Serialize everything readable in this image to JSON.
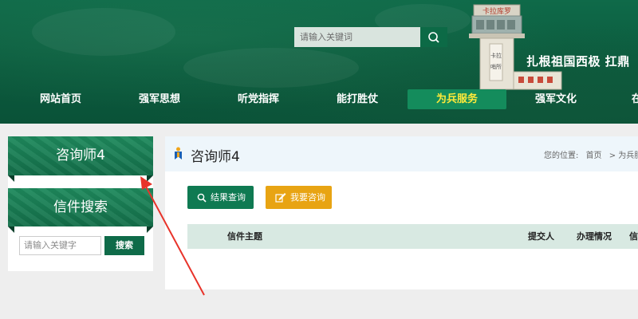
{
  "header": {
    "search": {
      "placeholder": "请输入关键词"
    },
    "tower_sign": "卡拉库罗",
    "slogan": "扎根祖国西极  扛鼎"
  },
  "nav": {
    "items": [
      {
        "label": "网站首页"
      },
      {
        "label": "强军思想"
      },
      {
        "label": "听党指挥"
      },
      {
        "label": "能打胜仗"
      },
      {
        "label": "为兵服务",
        "active": true
      },
      {
        "label": "强军文化"
      },
      {
        "label": "在"
      }
    ]
  },
  "sidebar": {
    "section_title": "咨询师4",
    "search_title": "信件搜索",
    "search_placeholder": "请输入关键字",
    "search_button": "搜索"
  },
  "main": {
    "title": "咨询师4",
    "breadcrumb": {
      "label": "您的位置:",
      "items": [
        "首页",
        "> 为兵服"
      ]
    },
    "buttons": {
      "query": "结果查询",
      "consult": "我要咨询"
    },
    "table": {
      "columns": [
        "信件主题",
        "提交人",
        "办理情况",
        "信"
      ]
    }
  },
  "colors": {
    "header_green": "#0b5a3d",
    "active_nav_bg": "#148c5c",
    "active_nav_text": "#ffea3a",
    "query_button": "#0f7a52",
    "consult_button": "#e8a413",
    "annotation_arrow": "#e8332a"
  }
}
